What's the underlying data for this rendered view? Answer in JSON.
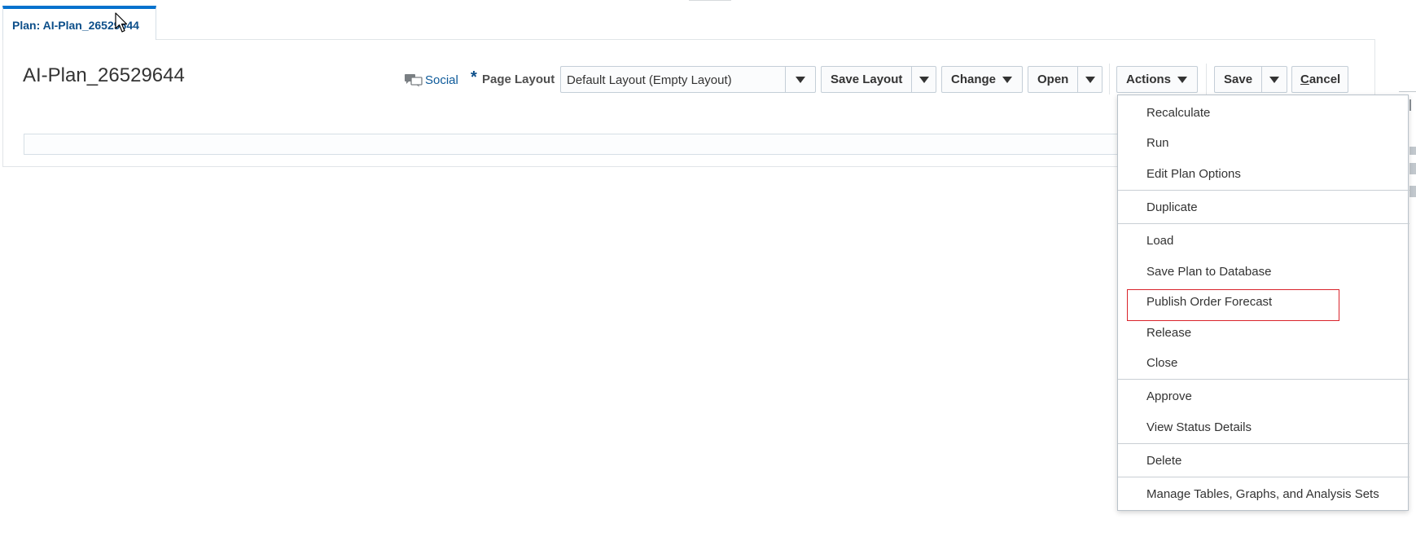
{
  "tab": {
    "label": "Plan: AI-Plan_26529644"
  },
  "page": {
    "title": "AI-Plan_26529644"
  },
  "header": {
    "social_label": "Social",
    "required_marker": "*",
    "page_layout_label": "Page Layout",
    "page_layout_value": "Default Layout (Empty Layout)"
  },
  "toolbar": {
    "save_layout_label": "Save Layout",
    "change_label": "Change",
    "open_label": "Open",
    "actions_label": "Actions",
    "save_label": "Save",
    "cancel_mnemonic": "C",
    "cancel_rest": "ancel"
  },
  "actions_menu": {
    "items": [
      "Recalculate",
      "Run",
      "Edit Plan Options",
      "Duplicate",
      "Load",
      "Save Plan to Database",
      "Publish Order Forecast",
      "Release",
      "Close",
      "Approve",
      "View Status Details",
      "Delete",
      "Manage Tables, Graphs, and Analysis Sets"
    ],
    "highlighted_item": "Publish Order Forecast"
  },
  "colors": {
    "accent": "#0572ce",
    "link": "#0d5a9a",
    "highlight_border": "#d9242b",
    "border": "#c4ced7"
  },
  "icons": {
    "social": "social-chat-icon",
    "dropdown": "caret-down-icon",
    "pointer": "mouse-cursor-icon"
  }
}
